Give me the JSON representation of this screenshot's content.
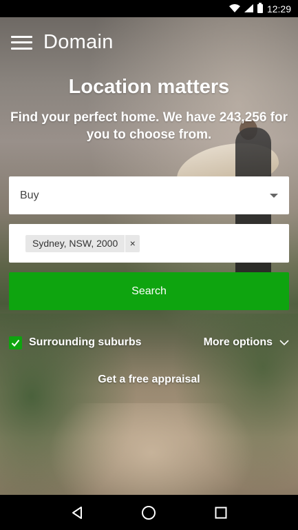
{
  "status_bar": {
    "time": "12:29"
  },
  "header": {
    "brand": "Domain"
  },
  "hero": {
    "headline": "Location matters",
    "subheadline": "Find your perfect home. We have 243,256 for you to choose from."
  },
  "search_form": {
    "type_selected": "Buy",
    "location_chip": "Sydney, NSW, 2000",
    "chip_remove": "×",
    "search_label": "Search",
    "surrounding_label": "Surrounding suburbs",
    "surrounding_checked": true,
    "more_options_label": "More options"
  },
  "appraisal_link": "Get a free appraisal",
  "colors": {
    "accent": "#0ea40f"
  },
  "icons": [
    "wifi-icon",
    "cell-signal-icon",
    "battery-icon",
    "hamburger-menu-icon",
    "dropdown-caret-icon",
    "close-icon",
    "checkmark-icon",
    "chevron-down-icon",
    "back-icon",
    "home-icon",
    "recents-icon"
  ]
}
